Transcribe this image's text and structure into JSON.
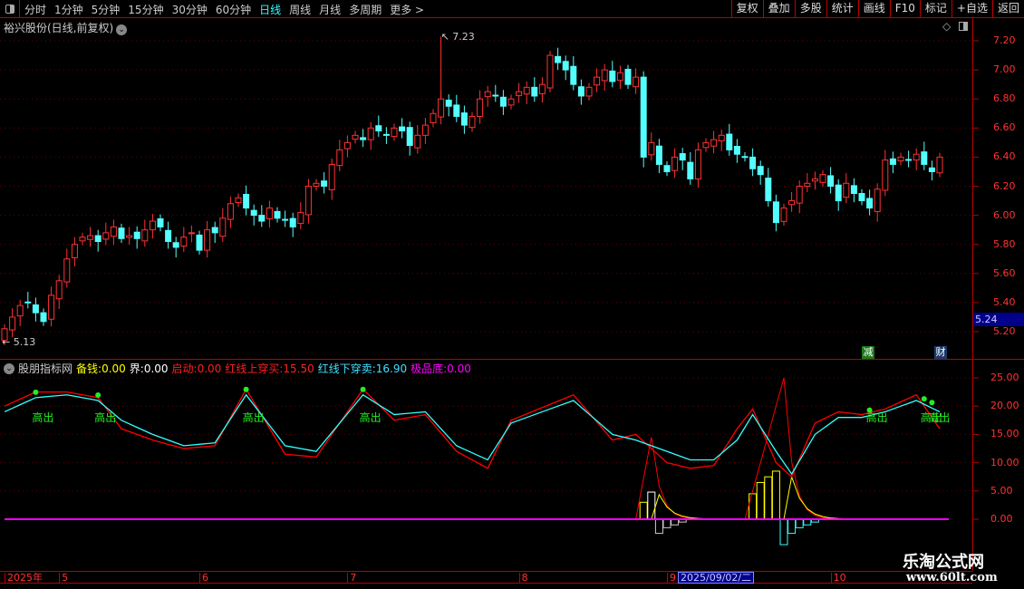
{
  "topbar": {
    "periods": [
      "分时",
      "1分钟",
      "5分钟",
      "15分钟",
      "30分钟",
      "60分钟",
      "日线",
      "周线",
      "月线",
      "多周期",
      "更多 >"
    ],
    "active_period": "日线",
    "tools": [
      "复权",
      "叠加",
      "多股",
      "统计",
      "画线",
      "F10",
      "标记",
      "+自选",
      "返回"
    ]
  },
  "chart": {
    "title": "裕兴股份(日线,前复权)",
    "price_ticks": [
      "7.20",
      "7.00",
      "6.80",
      "6.60",
      "6.40",
      "6.20",
      "6.00",
      "5.80",
      "5.60",
      "5.40",
      "5.20"
    ],
    "current_price": "5.24",
    "high_label": "7.23",
    "low_label": "5.13",
    "badges": [
      {
        "text": "减",
        "color": "#1a7a1a"
      },
      {
        "text": "财",
        "color": "#1a3a6a"
      }
    ],
    "colors": {
      "up": "#ff3232",
      "down": "#54ffff"
    },
    "closes": [
      5.22,
      5.3,
      5.38,
      5.4,
      5.33,
      5.27,
      5.45,
      5.55,
      5.7,
      5.8,
      5.85,
      5.86,
      5.82,
      5.88,
      5.92,
      5.84,
      5.86,
      5.84,
      5.9,
      5.96,
      5.92,
      5.82,
      5.78,
      5.85,
      5.88,
      5.76,
      5.9,
      5.88,
      5.98,
      6.08,
      6.12,
      6.05,
      6.0,
      5.96,
      6.05,
      5.98,
      5.97,
      5.92,
      6.02,
      6.2,
      6.22,
      6.2,
      6.35,
      6.45,
      6.5,
      6.55,
      6.52,
      6.6,
      6.58,
      6.55,
      6.6,
      6.58,
      6.48,
      6.55,
      6.62,
      6.7,
      6.8,
      6.75,
      6.68,
      6.62,
      6.68,
      6.8,
      6.85,
      6.82,
      6.75,
      6.8,
      6.85,
      6.88,
      6.82,
      6.9,
      7.1,
      7.05,
      7.0,
      6.9,
      6.82,
      6.88,
      6.95,
      7.0,
      6.92,
      6.98,
      6.9,
      6.95,
      6.4,
      6.5,
      6.35,
      6.3,
      6.4,
      6.38,
      6.25,
      6.45,
      6.5,
      6.52,
      6.55,
      6.45,
      6.42,
      6.4,
      6.32,
      6.28,
      6.1,
      5.95,
      6.05,
      6.1,
      6.2,
      6.22,
      6.25,
      6.28,
      6.2,
      6.1,
      6.22,
      6.15,
      6.1,
      6.05,
      6.18,
      6.38,
      6.35,
      6.4,
      6.38,
      6.42,
      6.35,
      6.3,
      6.4
    ]
  },
  "indicator": {
    "name": "股朋指标网",
    "fields": [
      {
        "label": "备钱:",
        "value": "0.00",
        "color": "#ffff00"
      },
      {
        "label": "界:",
        "value": "0.00",
        "color": "#ffffff"
      },
      {
        "label": "启动:",
        "value": "0.00",
        "color": "#ff2020"
      },
      {
        "label": "红线上穿买:",
        "value": "15.50",
        "color": "#ff2020"
      },
      {
        "label": "红线下穿卖:",
        "value": "16.90",
        "color": "#40e0ff"
      },
      {
        "label": "极品底:",
        "value": "0.00",
        "color": "#ff00ff"
      }
    ],
    "ticks": [
      "25.00",
      "20.00",
      "15.00",
      "10.00",
      "5.00",
      "0.00"
    ],
    "signal_label": "高出",
    "signals": [
      4,
      12,
      31,
      46,
      111,
      118,
      119
    ],
    "cyan_keys": [
      [
        0,
        19
      ],
      [
        4,
        21.5
      ],
      [
        8,
        22
      ],
      [
        12,
        21
      ],
      [
        15,
        17.5
      ],
      [
        19,
        15
      ],
      [
        23,
        13
      ],
      [
        27,
        13.5
      ],
      [
        31,
        22
      ],
      [
        36,
        13
      ],
      [
        40,
        12
      ],
      [
        46,
        22
      ],
      [
        50,
        18.5
      ],
      [
        54,
        19
      ],
      [
        58,
        13
      ],
      [
        62,
        10.5
      ],
      [
        65,
        17
      ],
      [
        73,
        21
      ],
      [
        78,
        15
      ],
      [
        81,
        14
      ],
      [
        85,
        12
      ],
      [
        88,
        10.5
      ],
      [
        91,
        10.5
      ],
      [
        94,
        14
      ],
      [
        96,
        18.5
      ],
      [
        99,
        12
      ],
      [
        101,
        8
      ],
      [
        104,
        15
      ],
      [
        107,
        18
      ],
      [
        110,
        18
      ],
      [
        113,
        19
      ],
      [
        117,
        21
      ],
      [
        120,
        19
      ]
    ],
    "red_keys": [
      [
        0,
        20
      ],
      [
        4,
        22.5
      ],
      [
        8,
        22.5
      ],
      [
        12,
        21.5
      ],
      [
        15,
        16
      ],
      [
        19,
        14
      ],
      [
        23,
        12.5
      ],
      [
        27,
        13
      ],
      [
        31,
        23
      ],
      [
        36,
        11.5
      ],
      [
        40,
        11
      ],
      [
        46,
        23
      ],
      [
        50,
        17.5
      ],
      [
        54,
        18.5
      ],
      [
        58,
        12
      ],
      [
        62,
        9
      ],
      [
        65,
        17.5
      ],
      [
        73,
        22
      ],
      [
        78,
        14
      ],
      [
        81,
        15
      ],
      [
        85,
        10
      ],
      [
        88,
        9
      ],
      [
        91,
        9.5
      ],
      [
        94,
        16
      ],
      [
        96,
        19.5
      ],
      [
        99,
        10
      ],
      [
        101,
        7.5
      ],
      [
        104,
        17
      ],
      [
        107,
        19
      ],
      [
        110,
        18.5
      ],
      [
        113,
        19.5
      ],
      [
        117,
        22
      ],
      [
        120,
        16
      ]
    ],
    "spikes": [
      {
        "start": 81,
        "peak": 83,
        "end": 89,
        "value": 14.5
      },
      {
        "start": 95,
        "peak": 100,
        "end": 106,
        "value": 25
      }
    ],
    "yellow_bars": [
      [
        82,
        3
      ],
      [
        83,
        4.8
      ],
      [
        96,
        4.5
      ],
      [
        97,
        6.5
      ],
      [
        98,
        7.5
      ],
      [
        99,
        8.5
      ]
    ],
    "cyan_bars": [
      [
        84,
        -2.5
      ],
      [
        85,
        -1.5
      ],
      [
        86,
        -1
      ],
      [
        87,
        -0.5
      ],
      [
        100,
        -4.5
      ],
      [
        101,
        -2.5
      ],
      [
        102,
        -1.5
      ],
      [
        103,
        -1
      ],
      [
        104,
        -0.5
      ]
    ]
  },
  "time_axis": {
    "labels": [
      {
        "text": "2025年",
        "bar": 0
      },
      {
        "text": "5",
        "bar": 7
      },
      {
        "text": "6",
        "bar": 25
      },
      {
        "text": "7",
        "bar": 44
      },
      {
        "text": "8",
        "bar": 66
      },
      {
        "text": "9",
        "bar": 85
      },
      {
        "text": "10",
        "bar": 106
      }
    ],
    "cursor_date": "2025/09/02/二"
  },
  "watermark": {
    "name": "乐淘公式网",
    "url": "www.60lt.com"
  }
}
